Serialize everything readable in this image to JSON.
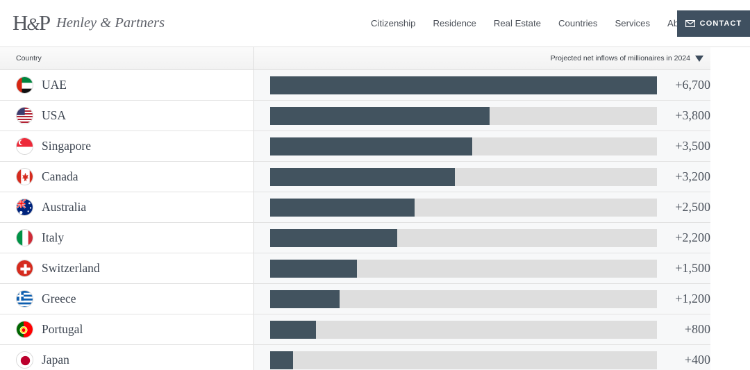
{
  "header": {
    "brand_mark": "H&P",
    "brand_name": "Henley & Partners",
    "nav": [
      {
        "label": "Citizenship"
      },
      {
        "label": "Residence"
      },
      {
        "label": "Real Estate"
      },
      {
        "label": "Countries"
      },
      {
        "label": "Services"
      },
      {
        "label": "About"
      }
    ],
    "contact_button": {
      "label": "CONTACT",
      "icon": "envelope-icon",
      "background": "#3f5060"
    }
  },
  "table": {
    "columns": {
      "country": "Country",
      "metric": "Projected net inflows of millionaires in 2024",
      "sort_indicator": "descending"
    }
  },
  "chart_data": {
    "type": "bar",
    "title": "Projected net inflows of millionaires in 2024",
    "xlabel": "",
    "ylabel": "Country",
    "orientation": "horizontal",
    "grid": false,
    "legend": false,
    "xlim": [
      0,
      6700
    ],
    "bar_color": "#42535f",
    "track_color": "#dedede",
    "categories": [
      "UAE",
      "USA",
      "Singapore",
      "Canada",
      "Australia",
      "Italy",
      "Switzerland",
      "Greece",
      "Portugal",
      "Japan"
    ],
    "values": [
      6700,
      3800,
      3500,
      3200,
      2500,
      2200,
      1500,
      1200,
      800,
      400
    ],
    "value_labels": [
      "+6,700",
      "+3,800",
      "+3,500",
      "+3,200",
      "+2,500",
      "+2,200",
      "+1,500",
      "+1,200",
      "+800",
      "+400"
    ],
    "rows": [
      {
        "rank": 1,
        "country": "UAE",
        "flag": "flag-ae",
        "value": 6700,
        "value_label": "+6,700",
        "pct": 100.0
      },
      {
        "rank": 2,
        "country": "USA",
        "flag": "flag-us",
        "value": 3800,
        "value_label": "+3,800",
        "pct": 56.7
      },
      {
        "rank": 3,
        "country": "Singapore",
        "flag": "flag-sg",
        "value": 3500,
        "value_label": "+3,500",
        "pct": 52.2
      },
      {
        "rank": 4,
        "country": "Canada",
        "flag": "flag-ca",
        "value": 3200,
        "value_label": "+3,200",
        "pct": 47.8
      },
      {
        "rank": 5,
        "country": "Australia",
        "flag": "flag-au",
        "value": 2500,
        "value_label": "+2,500",
        "pct": 37.3
      },
      {
        "rank": 6,
        "country": "Italy",
        "flag": "flag-it",
        "value": 2200,
        "value_label": "+2,200",
        "pct": 32.8
      },
      {
        "rank": 7,
        "country": "Switzerland",
        "flag": "flag-ch",
        "value": 1500,
        "value_label": "+1,500",
        "pct": 22.4
      },
      {
        "rank": 8,
        "country": "Greece",
        "flag": "flag-gr",
        "value": 1200,
        "value_label": "+1,200",
        "pct": 17.9
      },
      {
        "rank": 9,
        "country": "Portugal",
        "flag": "flag-pt",
        "value": 800,
        "value_label": "+800",
        "pct": 11.9
      },
      {
        "rank": 10,
        "country": "Japan",
        "flag": "flag-jp",
        "value": 400,
        "value_label": "+400",
        "pct": 6.0
      }
    ]
  }
}
